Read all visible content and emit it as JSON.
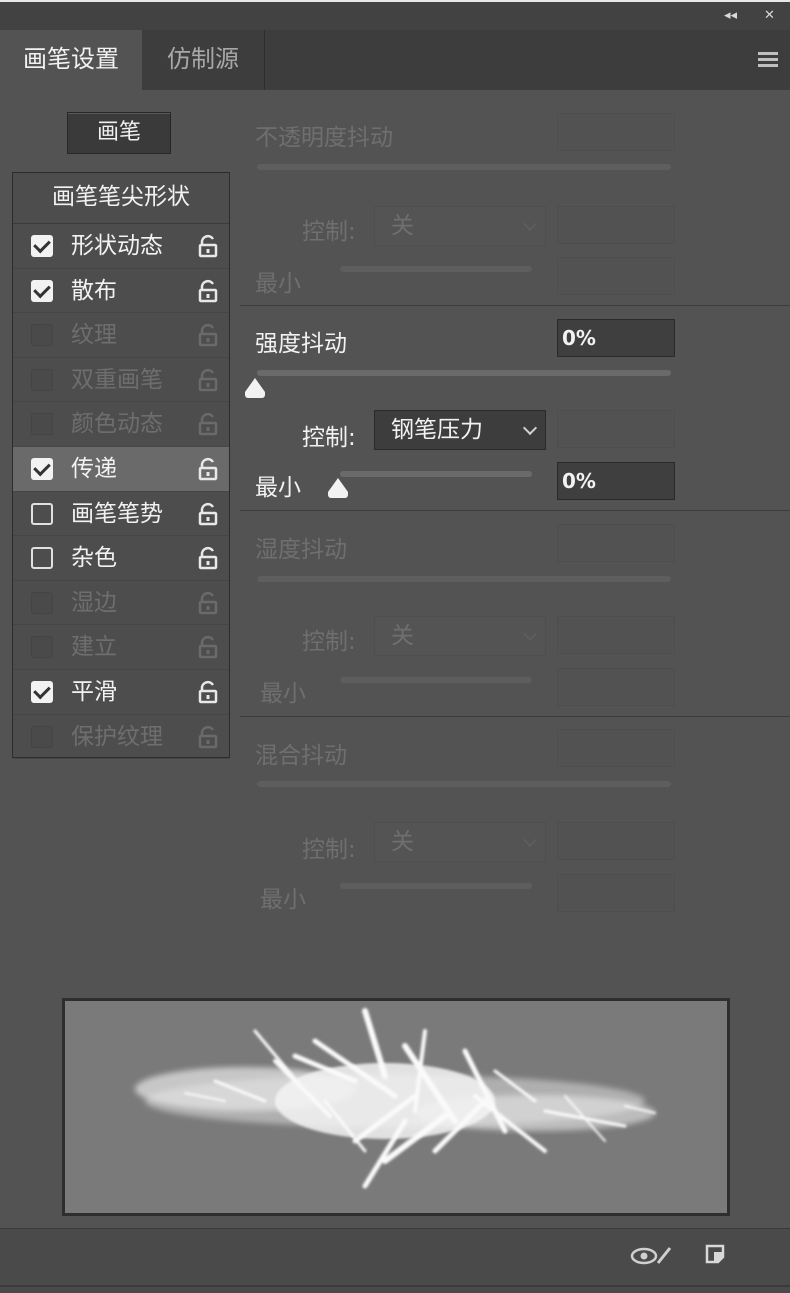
{
  "window": {
    "collapse_glyph": "◂◂",
    "close_glyph": "✕"
  },
  "tabs": [
    {
      "label": "画笔设置",
      "active": true
    },
    {
      "label": "仿制源",
      "active": false
    }
  ],
  "brush_button": "画笔",
  "list": {
    "header": "画笔笔尖形状",
    "items": [
      {
        "label": "形状动态",
        "state": "checked",
        "enabled": true
      },
      {
        "label": "散布",
        "state": "checked",
        "enabled": true
      },
      {
        "label": "纹理",
        "state": "disabled",
        "enabled": false
      },
      {
        "label": "双重画笔",
        "state": "disabled",
        "enabled": false
      },
      {
        "label": "颜色动态",
        "state": "disabled",
        "enabled": false
      },
      {
        "label": "传递",
        "state": "checked",
        "enabled": true,
        "selected": true
      },
      {
        "label": "画笔笔势",
        "state": "unchecked",
        "enabled": true
      },
      {
        "label": "杂色",
        "state": "unchecked",
        "enabled": true
      },
      {
        "label": "湿边",
        "state": "disabled",
        "enabled": false
      },
      {
        "label": "建立",
        "state": "disabled",
        "enabled": false
      },
      {
        "label": "平滑",
        "state": "checked",
        "enabled": true
      },
      {
        "label": "保护纹理",
        "state": "disabled",
        "enabled": false
      }
    ]
  },
  "settings": {
    "opacity_jitter": {
      "label": "不透明度抖动",
      "value": "",
      "control_label": "控制:",
      "control_value": "关",
      "min_label": "最小",
      "min_value": ""
    },
    "flow_jitter": {
      "label": "强度抖动",
      "value": "0%",
      "slider_level": 0,
      "control_label": "控制:",
      "control_value": "钢笔压力",
      "min_label": "最小",
      "min_value": "0%",
      "min_slider_level": 0
    },
    "wetness_jitter": {
      "label": "湿度抖动",
      "value": "",
      "control_label": "控制:",
      "control_value": "关",
      "min_label": "最小",
      "min_value": ""
    },
    "mix_jitter": {
      "label": "混合抖动",
      "value": "",
      "control_label": "控制:",
      "control_value": "关",
      "min_label": "最小",
      "min_value": ""
    }
  },
  "colors": {
    "panel_bg": "#535353",
    "enabled_text": "#f2f2f2",
    "disabled_text": "#6f6f6f"
  },
  "footer": {
    "icons": [
      "eye-brush-icon",
      "new-preset-icon"
    ]
  }
}
